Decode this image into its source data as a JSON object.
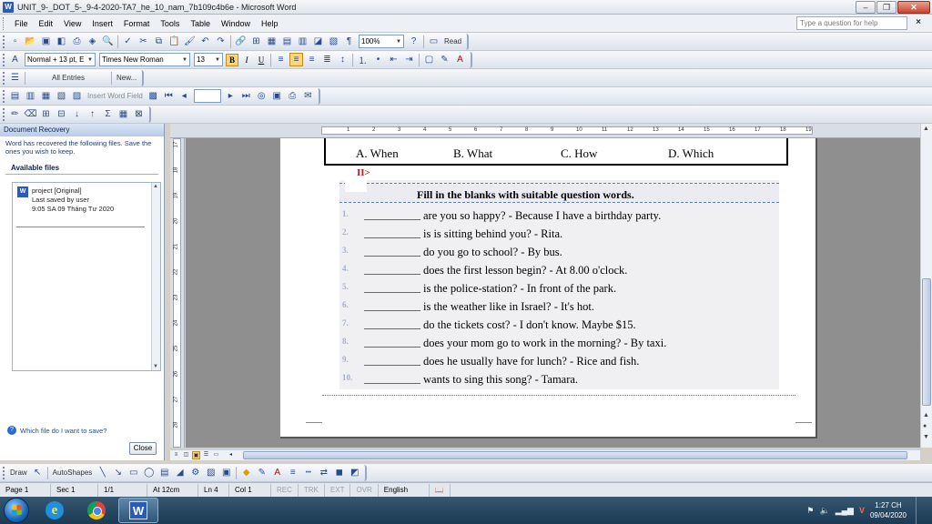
{
  "window": {
    "title": "UNIT_9-_DOT_5-_9-4-2020-TA7_he_10_nam_7b109c4b6e - Microsoft Word"
  },
  "menu": {
    "items": [
      "File",
      "Edit",
      "View",
      "Insert",
      "Format",
      "Tools",
      "Table",
      "Window",
      "Help"
    ],
    "help_placeholder": "Type a question for help"
  },
  "toolbar_standard": {
    "zoom": "100%",
    "read_label": "Read"
  },
  "toolbar_formatting": {
    "style": "Normal + 13 pt, E",
    "font": "Times New Roman",
    "size": "13"
  },
  "toolbar_autotext": {
    "entries": "All Entries",
    "new": "New..."
  },
  "toolbar_forms": {
    "insert_word_field": "Insert Word Field"
  },
  "task_pane": {
    "title": "Document Recovery",
    "message": "Word has recovered the following files.  Save the ones you wish to keep.",
    "available_files": "Available files",
    "file_name": "project  [Original]",
    "file_saved_by": "Last saved by user",
    "file_time": "9:05 SA 09 Tháng Tư 2020",
    "help_link": "Which file do I want to save?",
    "close_button": "Close"
  },
  "document": {
    "options": [
      "A. When",
      "B. What",
      "C. How",
      "D. Which"
    ],
    "section_mark": "II>",
    "exercise_title": "Fill in the blanks with suitable question words.",
    "items": [
      {
        "num": "1.",
        "text": "are you so happy? - Because I have a birthday party."
      },
      {
        "num": "2.",
        "text": " is is sitting behind you? - Rita."
      },
      {
        "num": "3.",
        "text": "do you go to school? - By bus."
      },
      {
        "num": "4.",
        "text": " does the first lesson begin? - At 8.00 o'clock."
      },
      {
        "num": "5.",
        "text": " is the police-station? - In front of the park."
      },
      {
        "num": "6.",
        "text": "is the weather like in Israel? - It's hot."
      },
      {
        "num": "7.",
        "text": "do the tickets cost? - I don't know. Maybe  $15."
      },
      {
        "num": "8.",
        "text": "does your mom go to work in the morning? - By taxi."
      },
      {
        "num": "9.",
        "text": "does he usually have for lunch? - Rice and fish."
      },
      {
        "num": "10.",
        "text": " wants to sing this  song? - Tamara."
      }
    ]
  },
  "drawing_toolbar": {
    "draw": "Draw",
    "autoshapes": "AutoShapes"
  },
  "status": {
    "page": "Page 1",
    "sec": "Sec 1",
    "pages": "1/1",
    "at": "At 12cm",
    "ln": "Ln 4",
    "col": "Col 1",
    "rec": "REC",
    "trk": "TRK",
    "ext": "EXT",
    "ovr": "OVR",
    "lang": "English (U.S."
  },
  "taskbar": {
    "time": "1:27 CH",
    "date": "09/04/2020"
  },
  "ruler": {
    "h_ticks": [
      "1",
      "2",
      "3",
      "4",
      "5",
      "6",
      "7",
      "8",
      "9",
      "10",
      "11",
      "12",
      "13",
      "14",
      "15",
      "16",
      "17",
      "18",
      "19"
    ],
    "v_ticks": [
      "17",
      "18",
      "19",
      "20",
      "21",
      "22",
      "23",
      "24",
      "25",
      "26",
      "27",
      "28"
    ]
  }
}
